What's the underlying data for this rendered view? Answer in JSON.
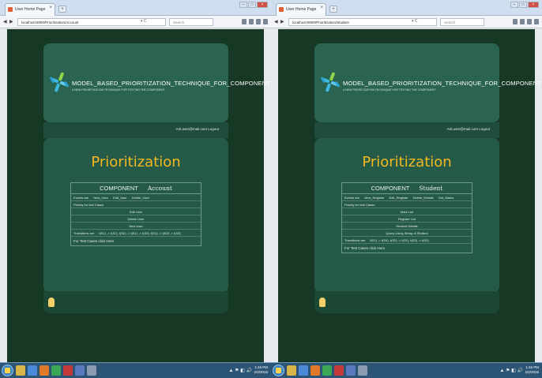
{
  "screens": [
    {
      "tab_title": "User Home Page",
      "address": "localhost:8080/Prioritization/Account",
      "search_placeholder": "Search",
      "brand": "MODEL_BASED_PRIORITIZATION_TECHNIQUE_FOR_COMPONENT",
      "tagline": "A NEW PRIORITIZATION TECHNIQUE FOR TESTING THE COMPONENT",
      "user_text": "Arti.user@mail.com   Logout",
      "page_title": "Prioritization",
      "component_label": "COMPONENT",
      "component_name": "Account",
      "events_label": "Events are",
      "events": [
        "New_User",
        "Edit_User",
        "Delete_User"
      ],
      "priority_label": "Priority for test Cases",
      "priority_items": [
        "Edit User",
        "Delete User",
        "New User"
      ],
      "transitions_label": "Transitions are",
      "transitions": "t(S1) -> t(S2), t(S2) -> t(S1) -> t(S3), t(S1) -> t(S2) -> t(S3)",
      "link_text": "For Test Cases click Here"
    },
    {
      "tab_title": "User Home Page",
      "address": "localhost:8080/Prioritization/Student",
      "search_placeholder": "Search",
      "brand": "MODEL_BASED_PRIORITIZATION_TECHNIQUE_FOR_COMPONENT",
      "tagline": "A NEW PRIORITIZATION TECHNIQUE FOR TESTING THE COMPONENT",
      "user_text": "Arti.user@mail.com   Logout",
      "page_title": "Prioritization",
      "component_label": "COMPONENT",
      "component_name": "Student",
      "events_label": "Events are",
      "events": [
        "New_Register",
        "Edit_Register",
        "Delete_Details",
        "Get_Marks"
      ],
      "priority_label": "Priority for test Cases",
      "priority_items": [
        "Mark List",
        "Register List",
        "Student Details",
        "Query Using String of Student"
      ],
      "transitions_label": "Transitions are",
      "transitions": "t(S1) -> t(S4), t(S2) -> t(S1), t(S3) -> t(S2)",
      "link_text": "For Test Cases click Here"
    }
  ],
  "taskbar": {
    "time": "1:46 PM",
    "date": "2/2/2015"
  },
  "colors": {
    "page_bg": "#183826",
    "header_bg": "#2a6451",
    "title": "#f5b820"
  }
}
